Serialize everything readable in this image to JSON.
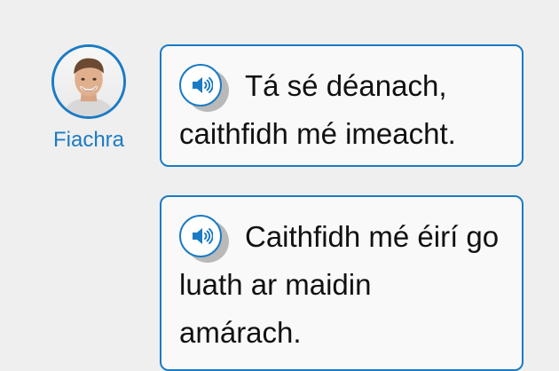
{
  "speaker": {
    "name": "Fiachra"
  },
  "messages": [
    {
      "text_line_1": "Tá sé déanach,",
      "text_line_2": "caithfidh mé imeacht."
    },
    {
      "text_line_1": "Caithfidh mé éirí go",
      "text_line_2": "luath ar maidin",
      "text_line_3": "amárach."
    }
  ],
  "icons": {
    "audio": "speaker-volume-icon"
  },
  "colors": {
    "accent": "#1b7bc4",
    "background": "#efefef",
    "bubble": "#f9f9f9",
    "text": "#111111"
  }
}
